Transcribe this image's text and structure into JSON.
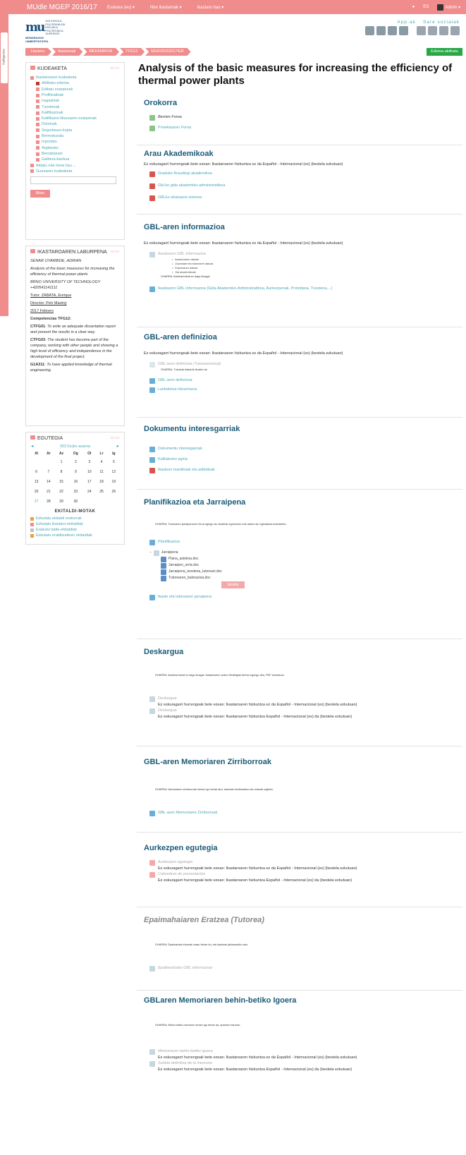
{
  "topbar": {
    "brand": "MUdle MGEP 2016/17",
    "nav": [
      "Euskara (eu) ▾",
      "Nire ikastaroak ▾",
      "Ikastaro hau ▾"
    ],
    "lang": "ES",
    "user": "Admin ▾",
    "drawer": "Nabigazioa"
  },
  "header": {
    "logo_mark": "mu",
    "logo_lines": [
      "GOI ESKOLA",
      "POLITEKNIKOA",
      "ESCUELA",
      "POLITÉCNICA",
      "SUPERIOR"
    ],
    "logo_sub": [
      "MONDRAGON",
      "UNIBERTSITATEA"
    ],
    "app_label": "App-ak",
    "social_label": "Sare sozialak"
  },
  "breadcrumbs": [
    "Hasiera",
    "Ikastaroak",
    "MEKANIKOA",
    "TFG12",
    "MGR20162017/ER"
  ],
  "edit_button": "Edizioa aktibatu",
  "admin_block": {
    "title": "KUDEAKETA",
    "controls": "▭▭",
    "items": [
      {
        "label": "Ikastaroaren kudeaketa",
        "level": 0,
        "color": "#f08c8c"
      },
      {
        "label": "Aktibatu edizioa",
        "level": 1,
        "color": "#c0392b"
      },
      {
        "label": "Editatu ezarpenak",
        "level": 1,
        "color": "#f08c8c"
      },
      {
        "label": "Profiltzaileak",
        "level": 1,
        "color": "#f08c8c"
      },
      {
        "label": "Iragazkiak",
        "level": 1,
        "color": "#f08c8c"
      },
      {
        "label": "Txostenak",
        "level": 1,
        "color": "#f08c8c"
      },
      {
        "label": "Kalifikazioak",
        "level": 1,
        "color": "#f08c8c"
      },
      {
        "label": "Kalifikazio liburuaren ezarpenak",
        "level": 1,
        "color": "#f08c8c"
      },
      {
        "label": "Dominak",
        "level": 1,
        "color": "#f08c8c"
      },
      {
        "label": "Segurtasun-kopia",
        "level": 1,
        "color": "#f08c8c"
      },
      {
        "label": "Berreskuratu",
        "level": 1,
        "color": "#f08c8c"
      },
      {
        "label": "Inportatu",
        "level": 1,
        "color": "#f08c8c"
      },
      {
        "label": "Argitaratu",
        "level": 1,
        "color": "#f08c8c"
      },
      {
        "label": "Berrabiarazi",
        "level": 1,
        "color": "#f08c8c"
      },
      {
        "label": "Galdera-bankua",
        "level": 1,
        "color": "#f08c8c"
      },
      {
        "label": "Aldatu rola hona hau ...",
        "level": 0,
        "color": "#f08c8c"
      },
      {
        "label": "Gunearen kudeaketa",
        "level": 0,
        "color": "#f08c8c"
      }
    ],
    "search_button": "Bilatu"
  },
  "course_block": {
    "title": "IKASTAROAREN LABURPENA",
    "author": "SENAR OYARBIDE, ADRIAN",
    "summary": "Analysis of the basic measures for increasing the efficiency of thermal power plants",
    "school": "BRNO UNIVERSITY OF TECHNOLOGY",
    "phone": "+420541141111",
    "tutor": "Tutor: ZABATA, Enrique",
    "director": "Director: Petr Mastný",
    "date": "2017 Febrero",
    "comp_title": "Competencias TFG12:",
    "competencies": [
      {
        "code": "CTFG01",
        "text": ": To write an adequate dissertation report and present the results in a clear way."
      },
      {
        "code": "CTFG03",
        "text": ": The student has become part of the company, working with other people and showing a high level of efficiency and independence in the development of the final project."
      },
      {
        "code": "G1A311",
        "text": ": To have applied knowledge of thermal engineering."
      }
    ]
  },
  "calendar_block": {
    "title": "EGUTEGIA",
    "prev": "◄",
    "month": "2017(e)ko azaroa",
    "next": "►",
    "days": [
      "Al",
      "Ar",
      "Az",
      "Og",
      "Ol",
      "Lr",
      "Ig"
    ],
    "weeks": [
      [
        "",
        "",
        "1",
        "2",
        "3",
        "4",
        "5"
      ],
      [
        "6",
        "7",
        "8",
        "9",
        "10",
        "11",
        "12"
      ],
      [
        "13",
        "14",
        "15",
        "16",
        "17",
        "18",
        "19"
      ],
      [
        "20",
        "21",
        "22",
        "23",
        "24",
        "25",
        "26"
      ],
      [
        "27",
        "28",
        "29",
        "30",
        "",
        "",
        ""
      ]
    ],
    "events_title": "EKITALDI-MOTAK",
    "events": [
      {
        "label": "Ezkutatu ekitaldi orokorrak",
        "color": "#e6a23c"
      },
      {
        "label": "Ezkutatu ikastaro-ekitaldiak",
        "color": "#f08c8c"
      },
      {
        "label": "Erakutsi talde-ekitaldiak",
        "color": "#c0c0c0"
      },
      {
        "label": "Ezkutatu erabiltzaileen ekitaldiak",
        "color": "#e6a23c"
      }
    ]
  },
  "main": {
    "page_title": "Analysis of the basic measures for increasing the efficiency of thermal power plants",
    "orokorra": {
      "title": "Orokorra",
      "items": [
        "Berrien Foroa",
        "Proiektuaren Foroa"
      ]
    },
    "arau": {
      "title": "Arau Akademikoak",
      "notice": "Ez eskuragarri hurrengoak bete ezean: Ikastaroaren hizkuntza ez da Español - Internacional (es) (bestela ezkutuan)",
      "items": [
        "Graduko Araudiegi akademikoa",
        "Gbl-ko gida akademiko-administratiboa",
        "GBLko ebaluazio sistema"
      ]
    },
    "gbl_info": {
      "title": "GBL-aren informazioa",
      "notice": "Ez eskuragarri hurrengoak bete ezean: Ikastaroaren hizkuntza ez da Español - Internacional (es) (bestela ezkutuan)",
      "dim_item": "Ikaslearen GBL informazioa",
      "bullets": [
        "Ikastaroaren datuak",
        "Zuzendari eta tutorearen datuak",
        "Enpresaren datuak",
        "Gai akademikoak"
      ],
      "mini": "OHARRA: Ikaslearentzat ez dago ikusgai",
      "link": "Ikaslearen GBL informazioa (Gida Akademiko-Administratiboa, Aurkezpenak, Prototipoa, Txostena,...)"
    },
    "gbl_def": {
      "title": "GBL-aren definizioa",
      "notice": "Ez eskuragarri hurrengoak bete ezean: Ikastaroaren hizkuntza ez da Español - Internacional (es) (bestela ezkutuan)",
      "dim_item": "GBL-aren definizioa (Tutorearentzat)",
      "mini": "OHARRA: Tutoreak bakarrik ikusten du",
      "items": [
        "GBL-aren definizioa",
        "Lankidetza hitzarmena"
      ]
    },
    "dokumentu": {
      "title": "Dokumentu interesgarriak",
      "items": [
        "Dokumentu interesgarriak",
        "Kalitatezko agiria",
        "Ikasleen txantiloiak eta adibideak"
      ]
    },
    "plan": {
      "title": "Planifikazioa eta Jarraipena",
      "note": "OHARRA: Tutorearen jarraipenaren foroa egingo da, ikasleak eguneroko edo astero lan egindakoa kontatzeko.",
      "folder": "Planifikazioa",
      "subfolder": "Jarraipena",
      "files": [
        "Plana_astekoa.doc",
        "Jarraipen_orria.doc",
        "Jarraipena_txostena_tutoreari.doc",
        "Tutorearen_balorazioa.doc"
      ],
      "button": "Jarraitu",
      "link": "Ikasle eta tutorearen jarraipena"
    },
    "desk": {
      "title": "Deskargua",
      "note": "OHARRA: Ikaslearentzat ez dago ikusgai. Ikastaroaren azken fitxategiak bertan egongo dira, PDF formatuan.",
      "items": [
        {
          "label": "Deskargua",
          "avail": "Ez eskuragarri hurrengoak bete ezean: Ikastaroaren hizkuntza ez da Español - Internacional (es) (bestela ezkutuan)"
        },
        {
          "label": "Deskargua",
          "avail": "Ez eskuragarri hurrengoak bete ezean: Ikastaroaren hizkuntza Español - Internacional (es) da (bestela ezkutuan)"
        }
      ]
    },
    "zirrib": {
      "title": "GBL-aren Memoriaren Zirriborroak",
      "note": "OHARRA: Memoriaren zirriborroak hemen igo behar dira, tutoreak berrikusteko eta oharrak egiteko.",
      "link": "GBL-aren Memoriaren Zirriborroak"
    },
    "aurk": {
      "title": "Aurkezpen egutegia",
      "items": [
        {
          "label": "Aurkezpen egutegia",
          "avail": "Ez eskuragarri hurrengoak bete ezean: Ikastaroaren hizkuntza ez da Español - Internacional (es) (bestela ezkutuan)"
        },
        {
          "label": "Calendario de presentación",
          "avail": "Ez eskuragarri hurrengoak bete ezean: Ikastaroaren hizkuntza Español - Internacional (es) da (bestela ezkutuan)"
        }
      ]
    },
    "epai": {
      "title": "Epaimahaiaren Eratzea (Tutorea)",
      "note": "OHARRA: Epaimahaia tutoreak osatu behar du, eta ikasleari jakinaraziko zaio.",
      "link": "Epaileentzako GBL informazioa"
    },
    "igoera": {
      "title": "GBLaren Memoriaren behin-betiko Igoera",
      "note": "OHARRA: Behin-betiko memoria hemen igo behar da, epearen barruan.",
      "items": [
        {
          "label": "Memoriaren behin-betiko igoera",
          "avail": "Ez eskuragarri hurrengoak bete ezean: Ikastaroaren hizkuntza ez da Español - Internacional (es) (bestela ezkutuan)"
        },
        {
          "label": "Subida definitiva de la memoria",
          "avail": "Ez eskuragarri hurrengoak bete ezean: Ikastaroaren hizkuntza Español - Internacional (es) da (bestela ezkutuan)"
        }
      ]
    }
  }
}
